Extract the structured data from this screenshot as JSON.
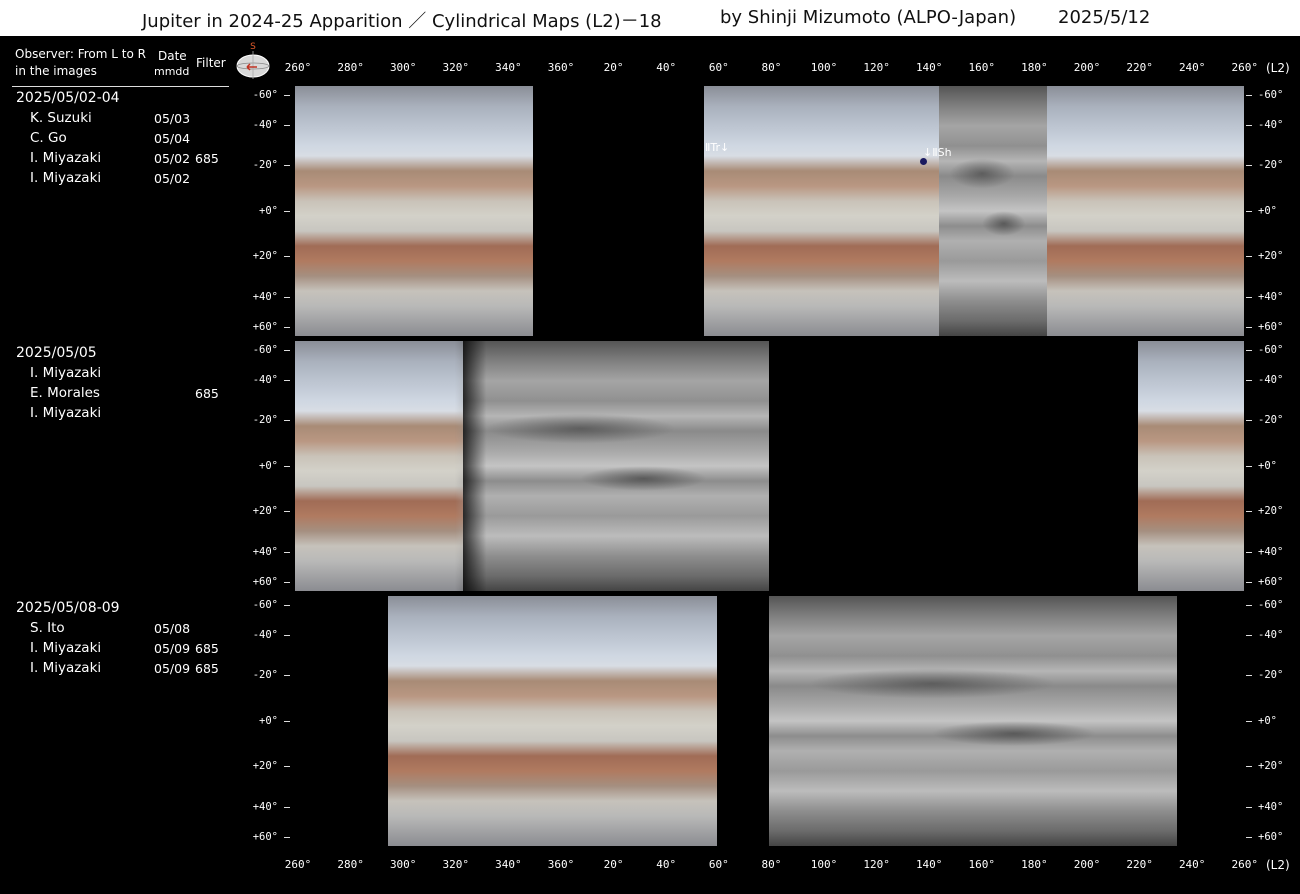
{
  "header": {
    "title": "Jupiter in 2024-25 Apparition ／ Cylindrical Maps (L2)－18",
    "author": "by Shinji Mizumoto (ALPO-Japan)",
    "date": "2025/5/12"
  },
  "sidebar": {
    "observer_heading_line1": "Observer: From L to R",
    "observer_heading_line2": "in the images",
    "date_heading_line1": "Date",
    "date_heading_line2": "mmdd",
    "filter_heading": "Filter",
    "north_marker": "S"
  },
  "groups": [
    {
      "title": "2025/05/02-04",
      "observers": [
        {
          "name": "K. Suzuki",
          "date": "05/03",
          "filter": ""
        },
        {
          "name": "C. Go",
          "date": "05/04",
          "filter": ""
        },
        {
          "name": "I. Miyazaki",
          "date": "05/02",
          "filter": "685"
        },
        {
          "name": "I. Miyazaki",
          "date": "05/02",
          "filter": ""
        }
      ]
    },
    {
      "title": "2025/05/05",
      "observers": [
        {
          "name": "I. Miyazaki",
          "date": "",
          "filter": ""
        },
        {
          "name": "E. Morales",
          "date": "",
          "filter": "685"
        },
        {
          "name": "I. Miyazaki",
          "date": "",
          "filter": ""
        }
      ]
    },
    {
      "title": "2025/05/08-09",
      "observers": [
        {
          "name": "S. Ito",
          "date": "05/08",
          "filter": ""
        },
        {
          "name": "I. Miyazaki",
          "date": "05/09",
          "filter": "685"
        },
        {
          "name": "I. Miyazaki",
          "date": "05/09",
          "filter": "685"
        }
      ]
    }
  ],
  "longitude_labels": [
    "260°",
    "280°",
    "300°",
    "320°",
    "340°",
    "360°",
    "20°",
    "40°",
    "60°",
    "80°",
    "100°",
    "120°",
    "140°",
    "160°",
    "180°",
    "200°",
    "220°",
    "240°",
    "260°"
  ],
  "longitude_unit": "(L2)",
  "latitude_labels": [
    "-60°",
    "-40°",
    "-20°",
    "+0°",
    "+20°",
    "+40°",
    "+60°"
  ],
  "annotations": {
    "tr": "ⅡTr↓",
    "sh": "↓ⅡSh"
  }
}
